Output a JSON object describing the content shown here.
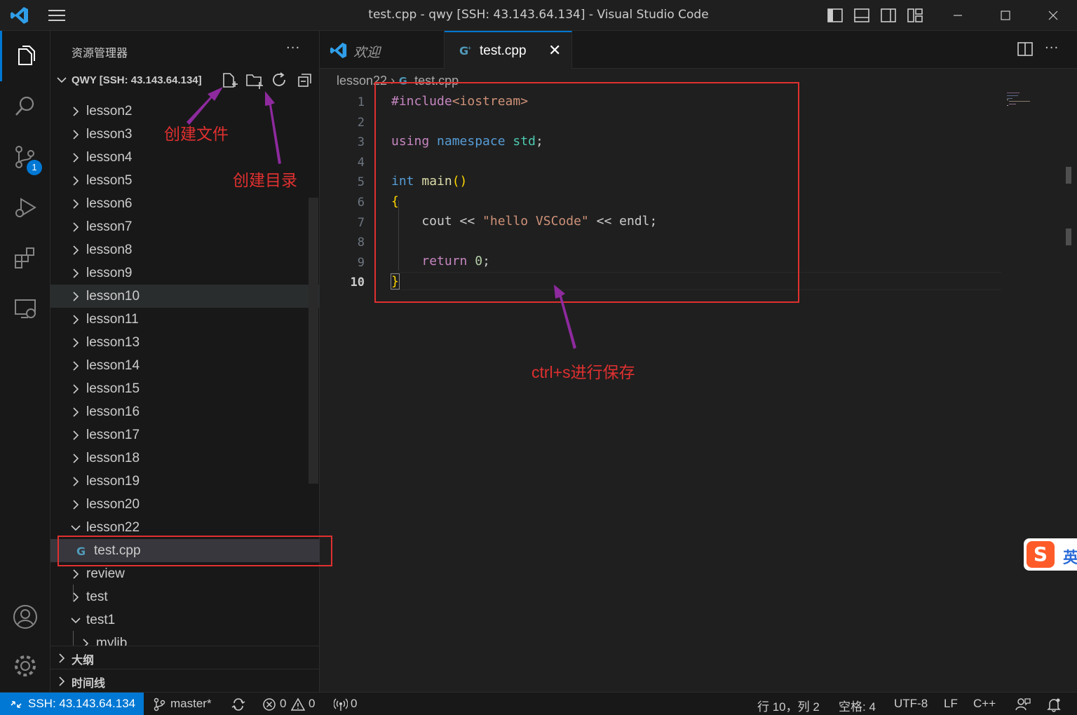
{
  "window": {
    "title": "test.cpp - qwy [SSH: 43.143.64.134] - Visual Studio Code"
  },
  "activity": {
    "scm_badge": "1"
  },
  "sidebar": {
    "header": "资源管理器",
    "more": "···",
    "workspace": "QWY [SSH: 43.143.64.134]",
    "items": [
      {
        "name": "lesson2",
        "expanded": false
      },
      {
        "name": "lesson3",
        "expanded": false
      },
      {
        "name": "lesson4",
        "expanded": false
      },
      {
        "name": "lesson5",
        "expanded": false
      },
      {
        "name": "lesson6",
        "expanded": false
      },
      {
        "name": "lesson7",
        "expanded": false
      },
      {
        "name": "lesson8",
        "expanded": false
      },
      {
        "name": "lesson9",
        "expanded": false
      },
      {
        "name": "lesson10",
        "expanded": false
      },
      {
        "name": "lesson11",
        "expanded": false
      },
      {
        "name": "lesson13",
        "expanded": false
      },
      {
        "name": "lesson14",
        "expanded": false
      },
      {
        "name": "lesson15",
        "expanded": false
      },
      {
        "name": "lesson16",
        "expanded": false
      },
      {
        "name": "lesson17",
        "expanded": false
      },
      {
        "name": "lesson18",
        "expanded": false
      },
      {
        "name": "lesson19",
        "expanded": false
      },
      {
        "name": "lesson20",
        "expanded": false
      },
      {
        "name": "lesson22",
        "expanded": true
      },
      {
        "name": "test.cpp",
        "file": true
      },
      {
        "name": "review",
        "expanded": false
      },
      {
        "name": "test",
        "expanded": false
      },
      {
        "name": "test1",
        "expanded": true
      },
      {
        "name": "mylib",
        "expanded": false
      }
    ],
    "outline": "大纲",
    "timeline": "时间线"
  },
  "tabs": [
    {
      "label": "欢迎"
    },
    {
      "label": "test.cpp"
    }
  ],
  "breadcrumb": {
    "folder": "lesson22",
    "file": "test.cpp"
  },
  "editor": {
    "line_numbers": [
      "1",
      "2",
      "3",
      "4",
      "5",
      "6",
      "7",
      "8",
      "9",
      "10"
    ],
    "current_line": "10"
  },
  "annotations": {
    "create_file": "创建文件",
    "create_folder": "创建目录",
    "save_hint": "ctrl+s进行保存"
  },
  "ime": {
    "logo": "S",
    "mode": "英"
  },
  "status": {
    "remote": "SSH: 43.143.64.134",
    "branch": "master*",
    "errors": "0",
    "warnings": "0",
    "ports": "0",
    "position": "行 10，列 2",
    "spaces": "空格: 4",
    "encoding": "UTF-8",
    "eol": "LF",
    "language": "C++"
  },
  "colors": {
    "accent": "#0078d4",
    "annotation": "#e03030",
    "arrow": "#8e2a9e"
  }
}
